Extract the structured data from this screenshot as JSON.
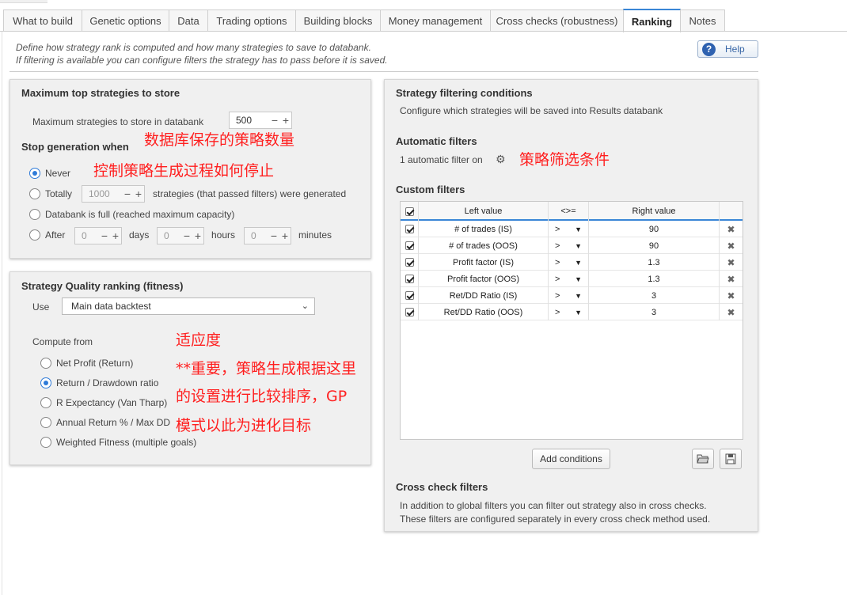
{
  "tabs": [
    {
      "label": "What to build"
    },
    {
      "label": "Genetic options"
    },
    {
      "label": "Data"
    },
    {
      "label": "Trading options"
    },
    {
      "label": "Building blocks"
    },
    {
      "label": "Money management"
    },
    {
      "label": "Cross checks (robustness)"
    },
    {
      "label": "Ranking",
      "active": true
    },
    {
      "label": "Notes"
    }
  ],
  "description": {
    "line1": "Define how strategy rank is computed and how many strategies to save to databank.",
    "line2": "If filtering is available you can configure filters the strategy has to pass before it is saved."
  },
  "help": {
    "label": "Help"
  },
  "top_panel": {
    "title": "Maximum top strategies to store",
    "max_label": "Maximum strategies to store in databank",
    "max_value": "500",
    "stop_title": "Stop generation when",
    "never_label": "Never",
    "totally_label": "Totally",
    "totally_value": "1000",
    "totally_suffix": "strategies (that passed filters) were generated",
    "databank_full_label": "Databank is full (reached maximum capacity)",
    "after_label": "After",
    "days_value": "0",
    "days_label": "days",
    "hours_value": "0",
    "hours_label": "hours",
    "minutes_value": "0",
    "minutes_label": "minutes",
    "selected": "never"
  },
  "fitness_panel": {
    "title": "Strategy Quality ranking (fitness)",
    "use_label": "Use",
    "use_value": "Main data backtest",
    "compute_label": "Compute from",
    "options": [
      {
        "label": "Net Profit (Return)",
        "selected": false
      },
      {
        "label": "Return / Drawdown ratio",
        "selected": true
      },
      {
        "label": "R Expectancy (Van Tharp)",
        "selected": false
      },
      {
        "label": "Annual Return % / Max DD",
        "selected": false
      },
      {
        "label": "Weighted Fitness (multiple goals)",
        "selected": false
      }
    ]
  },
  "filter_panel": {
    "title": "Strategy filtering conditions",
    "subtitle": "Configure which strategies will be saved into Results databank",
    "auto_title": "Automatic filters",
    "auto_text": "1 automatic filter on",
    "custom_title": "Custom filters",
    "columns": {
      "left": "Left value",
      "op": "<>=",
      "right": "Right value"
    },
    "rows": [
      {
        "left": "# of trades (IS)",
        "op": ">",
        "right": "90"
      },
      {
        "left": "# of trades (OOS)",
        "op": ">",
        "right": "90"
      },
      {
        "left": "Profit factor (IS)",
        "op": ">",
        "right": "1.3"
      },
      {
        "left": "Profit factor (OOS)",
        "op": ">",
        "right": "1.3"
      },
      {
        "left": "Ret/DD Ratio (IS)",
        "op": ">",
        "right": "3"
      },
      {
        "left": "Ret/DD Ratio (OOS)",
        "op": ">",
        "right": "3"
      }
    ],
    "add_label": "Add conditions",
    "cross_title": "Cross check filters",
    "cross_line1": "In addition to global filters you can filter out strategy also in cross checks.",
    "cross_line2": "These filters are configured separately in every cross check method used."
  },
  "annotations": {
    "db_count": "数据库保存的策略数量",
    "stop_ctrl": "控制策略生成过程如何停止",
    "filter_cond": "策略筛选条件",
    "fitness": "适应度",
    "note1": "**重要，策略生成根据这里",
    "note2": "的设置进行比较排序，GP",
    "note3": "模式以此为进化目标"
  },
  "colors": {
    "accent": "#3a86d6",
    "annotation": "#ff1f1f",
    "panel": "#f0f0f0"
  }
}
